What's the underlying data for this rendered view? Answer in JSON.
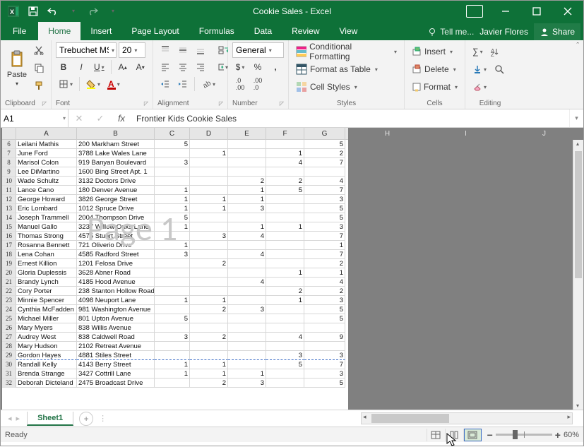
{
  "app": {
    "title": "Cookie Sales - Excel",
    "user": "Javier Flores",
    "share": "Share",
    "tell_me": "Tell me..."
  },
  "tabs": {
    "file": "File",
    "home": "Home",
    "insert": "Insert",
    "page_layout": "Page Layout",
    "formulas": "Formulas",
    "data": "Data",
    "review": "Review",
    "view": "View"
  },
  "ribbon": {
    "clipboard": {
      "label": "Clipboard",
      "paste": "Paste"
    },
    "font": {
      "label": "Font",
      "name": "Trebuchet MS",
      "size": "20",
      "bold": "B",
      "italic": "I",
      "underline": "U"
    },
    "alignment": {
      "label": "Alignment"
    },
    "number": {
      "label": "Number",
      "format": "General"
    },
    "styles": {
      "label": "Styles",
      "conditional": "Conditional Formatting",
      "table": "Format as Table",
      "cell": "Cell Styles"
    },
    "cells": {
      "label": "Cells",
      "insert": "Insert",
      "delete": "Delete",
      "format": "Format"
    },
    "editing": {
      "label": "Editing"
    }
  },
  "formula_bar": {
    "cell_ref": "A1",
    "formula": "Frontier Kids Cookie Sales"
  },
  "sheet": {
    "columns": [
      "A",
      "B",
      "C",
      "D",
      "E",
      "F",
      "G"
    ],
    "gray_columns": [
      "H",
      "I",
      "J"
    ],
    "watermark": "Page 1",
    "rows": [
      {
        "n": 6,
        "a": "Leilani Mathis",
        "b": "200 Markham Street",
        "c": "5",
        "d": "",
        "e": "",
        "f": "",
        "g": "5"
      },
      {
        "n": 7,
        "a": "June Ford",
        "b": "3788 Lake Wales Lane",
        "c": "",
        "d": "1",
        "e": "",
        "f": "1",
        "g": "2"
      },
      {
        "n": 8,
        "a": "Marisol Colon",
        "b": "919 Banyan Boulevard",
        "c": "3",
        "d": "",
        "e": "",
        "f": "4",
        "g": "7"
      },
      {
        "n": 9,
        "a": "Lee DiMartino",
        "b": "1600 Bing Street Apt. 1",
        "c": "",
        "d": "",
        "e": "",
        "f": "",
        "g": ""
      },
      {
        "n": 10,
        "a": "Wade Schultz",
        "b": "3132 Doctors Drive",
        "c": "",
        "d": "",
        "e": "2",
        "f": "2",
        "g": "4"
      },
      {
        "n": 11,
        "a": "Lance Cano",
        "b": "180 Denver Avenue",
        "c": "1",
        "d": "",
        "e": "1",
        "f": "5",
        "g": "7"
      },
      {
        "n": 12,
        "a": "George Howard",
        "b": "3826 George Street",
        "c": "1",
        "d": "1",
        "e": "1",
        "f": "",
        "g": "3"
      },
      {
        "n": 13,
        "a": "Eric Lombard",
        "b": "1012 Spruce Drive",
        "c": "1",
        "d": "1",
        "e": "3",
        "f": "",
        "g": "5"
      },
      {
        "n": 14,
        "a": "Joseph Trammell",
        "b": "2004 Thompson Drive",
        "c": "5",
        "d": "",
        "e": "",
        "f": "",
        "g": "5"
      },
      {
        "n": 15,
        "a": "Manuel Gallo",
        "b": "3237 Willow Oaks Lane",
        "c": "1",
        "d": "",
        "e": "1",
        "f": "1",
        "g": "3"
      },
      {
        "n": 16,
        "a": "Thomas Strong",
        "b": "4575 Stuart Street",
        "c": "",
        "d": "3",
        "e": "4",
        "f": "",
        "g": "7"
      },
      {
        "n": 17,
        "a": "Rosanna Bennett",
        "b": "721 Oliverio Drive",
        "c": "1",
        "d": "",
        "e": "",
        "f": "",
        "g": "1"
      },
      {
        "n": 18,
        "a": "Lena Cohan",
        "b": "4585 Radford Street",
        "c": "3",
        "d": "",
        "e": "4",
        "f": "",
        "g": "7"
      },
      {
        "n": 19,
        "a": "Ernest Killion",
        "b": "1201 Felosa Drive",
        "c": "",
        "d": "2",
        "e": "",
        "f": "",
        "g": "2"
      },
      {
        "n": 20,
        "a": "Gloria Duplessis",
        "b": "3628 Abner Road",
        "c": "",
        "d": "",
        "e": "",
        "f": "1",
        "g": "1"
      },
      {
        "n": 21,
        "a": "Brandy Lynch",
        "b": "4185 Hood Avenue",
        "c": "",
        "d": "",
        "e": "4",
        "f": "",
        "g": "4"
      },
      {
        "n": 22,
        "a": "Cory Porter",
        "b": "238 Stanton Hollow Road",
        "c": "",
        "d": "",
        "e": "",
        "f": "2",
        "g": "2"
      },
      {
        "n": 23,
        "a": "Minnie Spencer",
        "b": "4098 Neuport Lane",
        "c": "1",
        "d": "1",
        "e": "",
        "f": "1",
        "g": "3"
      },
      {
        "n": 24,
        "a": "Cynthia McFadden",
        "b": "981 Washington Avenue",
        "c": "",
        "d": "2",
        "e": "3",
        "f": "",
        "g": "5"
      },
      {
        "n": 25,
        "a": "Michael Miller",
        "b": "801 Upton Avenue",
        "c": "5",
        "d": "",
        "e": "",
        "f": "",
        "g": "5"
      },
      {
        "n": 26,
        "a": "Mary Myers",
        "b": "838 Willis Avenue",
        "c": "",
        "d": "",
        "e": "",
        "f": "",
        "g": ""
      },
      {
        "n": 27,
        "a": "Audrey West",
        "b": "838 Caldwell Road",
        "c": "3",
        "d": "2",
        "e": "",
        "f": "4",
        "g": "9"
      },
      {
        "n": 28,
        "a": "Mary Hudson",
        "b": "2102 Retreat Avenue",
        "c": "",
        "d": "",
        "e": "",
        "f": "",
        "g": ""
      },
      {
        "n": 29,
        "a": "Gordon Hayes",
        "b": "4881 Stiles Street",
        "c": "",
        "d": "",
        "e": "",
        "f": "3",
        "g": "3",
        "pb": true
      },
      {
        "n": 30,
        "a": "Randall Kelly",
        "b": "4143 Berry Street",
        "c": "1",
        "d": "1",
        "e": "",
        "f": "5",
        "g": "7"
      },
      {
        "n": 31,
        "a": "Brenda Strange",
        "b": "3427 Cottrill Lane",
        "c": "1",
        "d": "1",
        "e": "1",
        "f": "",
        "g": "3"
      },
      {
        "n": 32,
        "a": "Deborah Dicteland",
        "b": "2475 Broadcast Drive",
        "c": "",
        "d": "2",
        "e": "3",
        "f": "",
        "g": "5"
      }
    ]
  },
  "sheet_tabs": {
    "active": "Sheet1"
  },
  "status": {
    "ready": "Ready",
    "zoom": "60%"
  }
}
